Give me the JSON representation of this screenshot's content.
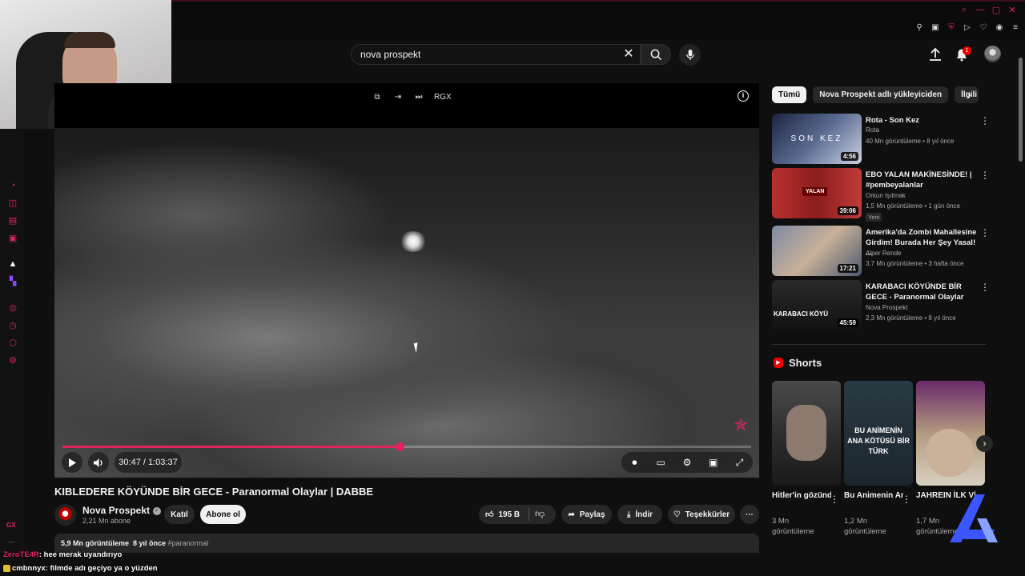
{
  "search": {
    "value": "nova prospekt"
  },
  "notifications": {
    "count": "1"
  },
  "player": {
    "time": "30:47 / 1:03:37",
    "progress_fraction": 0.49,
    "top_controls": [
      "⧉",
      "⇥",
      "⏭",
      "RGX"
    ]
  },
  "video": {
    "title": "KIBLEDERE KÖYÜNDE BİR GECE - Paranormal Olaylar | DABBE",
    "channel": "Nova Prospekt",
    "subscribers": "2,21 Mn abone",
    "join_label": "Katıl",
    "subscribe_label": "Abone ol",
    "likes": "195 B",
    "share_label": "Paylaş",
    "download_label": "İndir",
    "thanks_label": "Teşekkürler",
    "views": "5,9 Mn görüntüleme",
    "age": "8 yıl önce",
    "hashtag": "#paranormal"
  },
  "chips": [
    "Tümü",
    "Nova Prospekt adlı yükleyiciden",
    "İlgili"
  ],
  "recommendations": [
    {
      "title": "Rota - Son Kez",
      "channel": "Rota",
      "meta": "40 Mn görüntüleme • 8 yıl önce",
      "duration": "4:56",
      "thumb_text": "SON KEZ"
    },
    {
      "title": "EBO YALAN MAKİNESİNDE! | #pembeyalanlar",
      "channel": "Orkun Işıtmak",
      "meta": "1,5 Mn görüntüleme • 1 gün önce",
      "duration": "39:06",
      "badge": "Yeni",
      "thumb_text": "YALAN"
    },
    {
      "title": "Amerika'da Zombi Mahallesine Girdim! Burada Her Şey Yasal! ...",
      "channel": "Alper Rende",
      "meta": "3,7 Mn görüntüleme • 3 hafta önce",
      "duration": "17:21",
      "thumb_text": ""
    },
    {
      "title": "KARABACI KÖYÜNDE BİR GECE - Paranormal Olaylar",
      "channel": "Nova Prospekt",
      "meta": "2,3 Mn görüntüleme • 8 yıl önce",
      "duration": "45:59",
      "thumb_text": "KARABACI KÖYÜ"
    }
  ],
  "shorts": {
    "title": "Shorts",
    "items": [
      {
        "title": "Hitler'in gözünden ...",
        "views_line1": "3 Mn",
        "views_line2": "görüntüleme",
        "thumb_text": ""
      },
      {
        "title": "Bu Animenin Ana Kötüsü...",
        "views_line1": "1,2 Mn",
        "views_line2": "görüntüleme",
        "thumb_text": "BU ANİMENİN ANA KÖTÜSÜ BİR TÜRK"
      },
      {
        "title": "JAHREIN İLK VİDEOSU -",
        "views_line1": "1,7 Mn",
        "views_line2": "görüntüleme",
        "thumb_text": ""
      }
    ]
  },
  "chat": [
    {
      "user": "ZeroTE4R",
      "message": ": hee merak uyandırıyo"
    },
    {
      "user": "cmbnnyx",
      "message": ": filmde adı geçiyo ya o yüzden"
    }
  ],
  "sidebar": {
    "gx_label": "GX",
    "more_label": "···"
  },
  "colors": {
    "accent": "#e0245e",
    "background": "#0f0f0f",
    "chip": "#272727"
  }
}
